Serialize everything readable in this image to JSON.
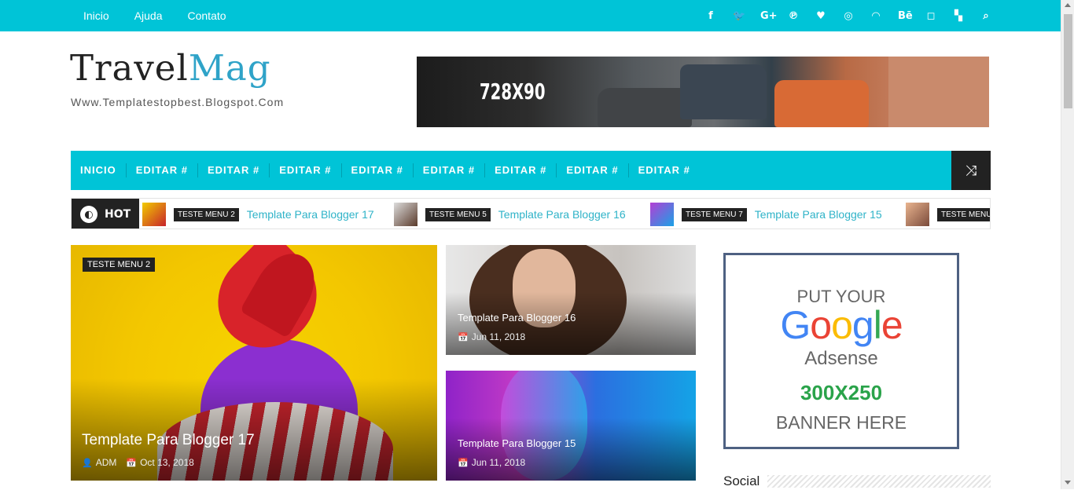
{
  "topbar": {
    "nav": [
      "Inicio",
      "Ajuda",
      "Contato"
    ],
    "social_icons": [
      "facebook-icon",
      "twitter-icon",
      "google-plus-icon",
      "pinterest-icon",
      "heart-icon",
      "dribbble-icon",
      "rss-icon",
      "behance-icon",
      "instagram-icon",
      "delicious-icon",
      "search-icon"
    ],
    "social_glyphs": [
      "f",
      "🐦",
      "G+",
      "℗",
      "♥",
      "◎",
      "◠",
      "Bē",
      "◻",
      "▚",
      "⌕"
    ]
  },
  "header": {
    "logo_main": "Travel",
    "logo_accent": "Mag",
    "tagline": "Www.Templatestopbest.Blogspot.Com",
    "banner_label": "728X90"
  },
  "mainmenu": {
    "items": [
      "INICIO",
      "EDITAR #",
      "EDITAR #",
      "EDITAR #",
      "EDITAR #",
      "EDITAR #",
      "EDITAR #",
      "EDITAR #",
      "EDITAR #"
    ],
    "shuffle_icon": "⤨"
  },
  "ticker": {
    "label": "HOT",
    "items": [
      {
        "tag": "TESTE MENU 2",
        "title": "Template Para Blogger 17"
      },
      {
        "tag": "TESTE MENU 5",
        "title": "Template Para Blogger 16"
      },
      {
        "tag": "TESTE MENU 7",
        "title": "Template Para Blogger 15"
      },
      {
        "tag": "TESTE MENU",
        "title": ""
      }
    ]
  },
  "featured": {
    "big": {
      "tag": "TESTE MENU 2",
      "title": "Template Para Blogger 17",
      "author": "ADM",
      "date": "Oct 13, 2018"
    },
    "small": [
      {
        "title": "Template Para Blogger 16",
        "date": "Jun 11, 2018"
      },
      {
        "title": "Template Para Blogger 15",
        "date": "Jun 11, 2018"
      }
    ]
  },
  "sidebar": {
    "ad": {
      "line1": "PUT YOUR",
      "google": "Google",
      "line3": "Adsense",
      "size": "300X250",
      "line5": "BANNER HERE"
    },
    "social_title": "Social"
  },
  "colors": {
    "accent": "#00c4d7",
    "dark": "#222222",
    "link": "#2fb3c8"
  }
}
